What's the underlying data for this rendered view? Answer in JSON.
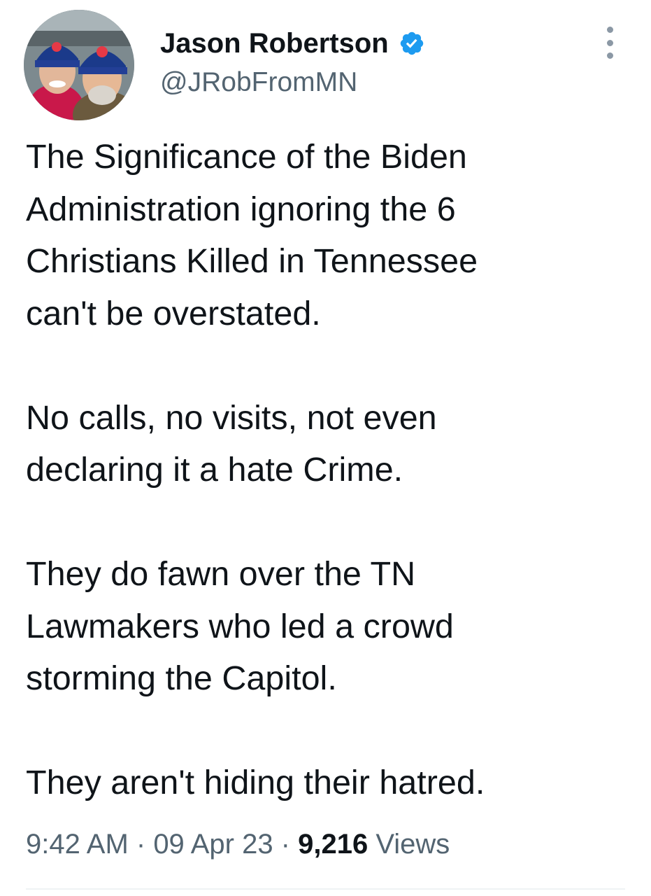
{
  "author": {
    "name": "Jason Robertson",
    "handle": "@JRobFromMN",
    "verified": true,
    "avatar": "avatar-photo-two-people-in-twins-beanies"
  },
  "tweet": {
    "paragraphs": [
      "The Significance of the Biden\nAdministration ignoring the 6\nChristians Killed in Tennessee\ncan't be overstated.",
      "No calls, no visits, not even\ndeclaring it a hate Crime.",
      "They do fawn over the TN\nLawmakers who led a crowd\nstorming the Capitol.",
      "They aren't hiding their hatred."
    ]
  },
  "meta": {
    "time": "9:42 AM",
    "separator": " · ",
    "date": "09 Apr 23",
    "views_count": "9,216",
    "views_label": " Views"
  },
  "icons": {
    "verified": "verified-badge-icon",
    "more": "more-options-icon"
  },
  "colors": {
    "verified_blue": "#1d9bf0",
    "text": "#0f1419",
    "secondary": "#536471"
  }
}
